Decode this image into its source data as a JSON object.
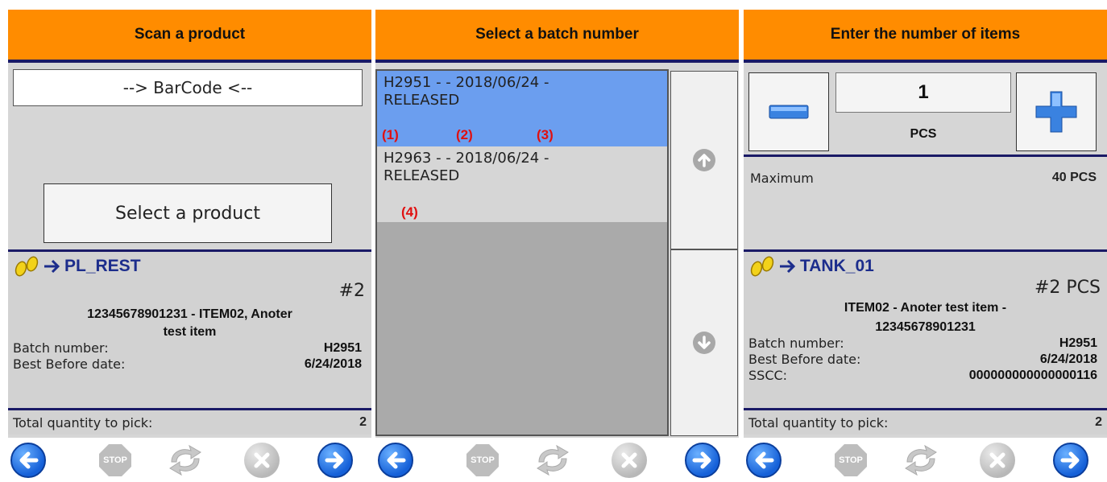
{
  "panel1": {
    "header": "Scan a product",
    "barcode_text": "--> BarCode <--",
    "select_button": "Select a product",
    "location": "PL_REST",
    "count": "#2",
    "desc_line1": "12345678901231 - ITEM02, Anoter",
    "desc_line2": "test item",
    "batch_label": "Batch number:",
    "batch_value": "H2951",
    "bbd_label": "Best Before date:",
    "bbd_value": "6/24/2018",
    "total_label": "Total quantity to pick:",
    "total_value": "2"
  },
  "panel2": {
    "header": "Select a batch number",
    "items": [
      {
        "line1": "H2951 -  - 2018/06/24 -",
        "line2": "RELEASED"
      },
      {
        "line1": "H2963 -  - 2018/06/24 -",
        "line2": "RELEASED"
      }
    ],
    "annotations": [
      "(1)",
      "(2)",
      "(3)",
      "(4)"
    ]
  },
  "panel3": {
    "header": "Enter the number of items",
    "quantity": "1",
    "unit": "PCS",
    "max_label": "Maximum",
    "max_value": "40 PCS",
    "location": "TANK_01",
    "count": "#2 PCS",
    "desc_line1": "ITEM02 - Anoter test item -",
    "desc_line2": "12345678901231",
    "batch_label": "Batch number:",
    "batch_value": "H2951",
    "bbd_label": "Best Before date:",
    "bbd_value": "6/24/2018",
    "sscc_label": "SSCC:",
    "sscc_value": "000000000000000116",
    "total_label": "Total quantity to pick:",
    "total_value": "2"
  },
  "toolbar": {
    "stop_label": "STOP",
    "icons": [
      "back-arrow-icon",
      "stop-icon",
      "refresh-icon",
      "cancel-icon",
      "forward-arrow-icon"
    ]
  },
  "colors": {
    "header": "#ff8c00",
    "accent": "#1a1a66",
    "selected": "#6b9eef",
    "location_text": "#1c2d8c",
    "annotation": "#e01010"
  }
}
